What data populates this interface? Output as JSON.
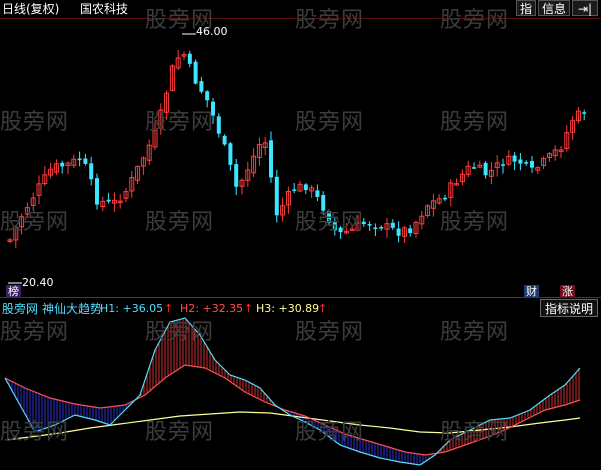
{
  "header": {
    "period": "日线(复权)",
    "stock_name": "国农科技",
    "btn_index": "指",
    "btn_info": "信息",
    "btn_arrow": "⇥|"
  },
  "watermark": "股旁网",
  "price_panel": {
    "high_label": "46.00",
    "low_label": "20.40",
    "badge_bang": "榜",
    "badge_cai": "财",
    "badge_zhang": "涨",
    "colors": {
      "up": "#ff3c3c",
      "down": "#3ce6ff"
    }
  },
  "indicator": {
    "site": "股旁网",
    "name": "神仙大趋势",
    "h1_label": "H1: +36.05",
    "h2_label": "H2: +32.35",
    "h3_label": "H3: +30.89",
    "arrow": "↑",
    "explain_button": "指标说明",
    "colors": {
      "h1": "#55ddff",
      "h2": "#ff5050",
      "h3": "#ffff99",
      "fill_up": "#d03030",
      "fill_down": "#3030d0"
    }
  }
}
